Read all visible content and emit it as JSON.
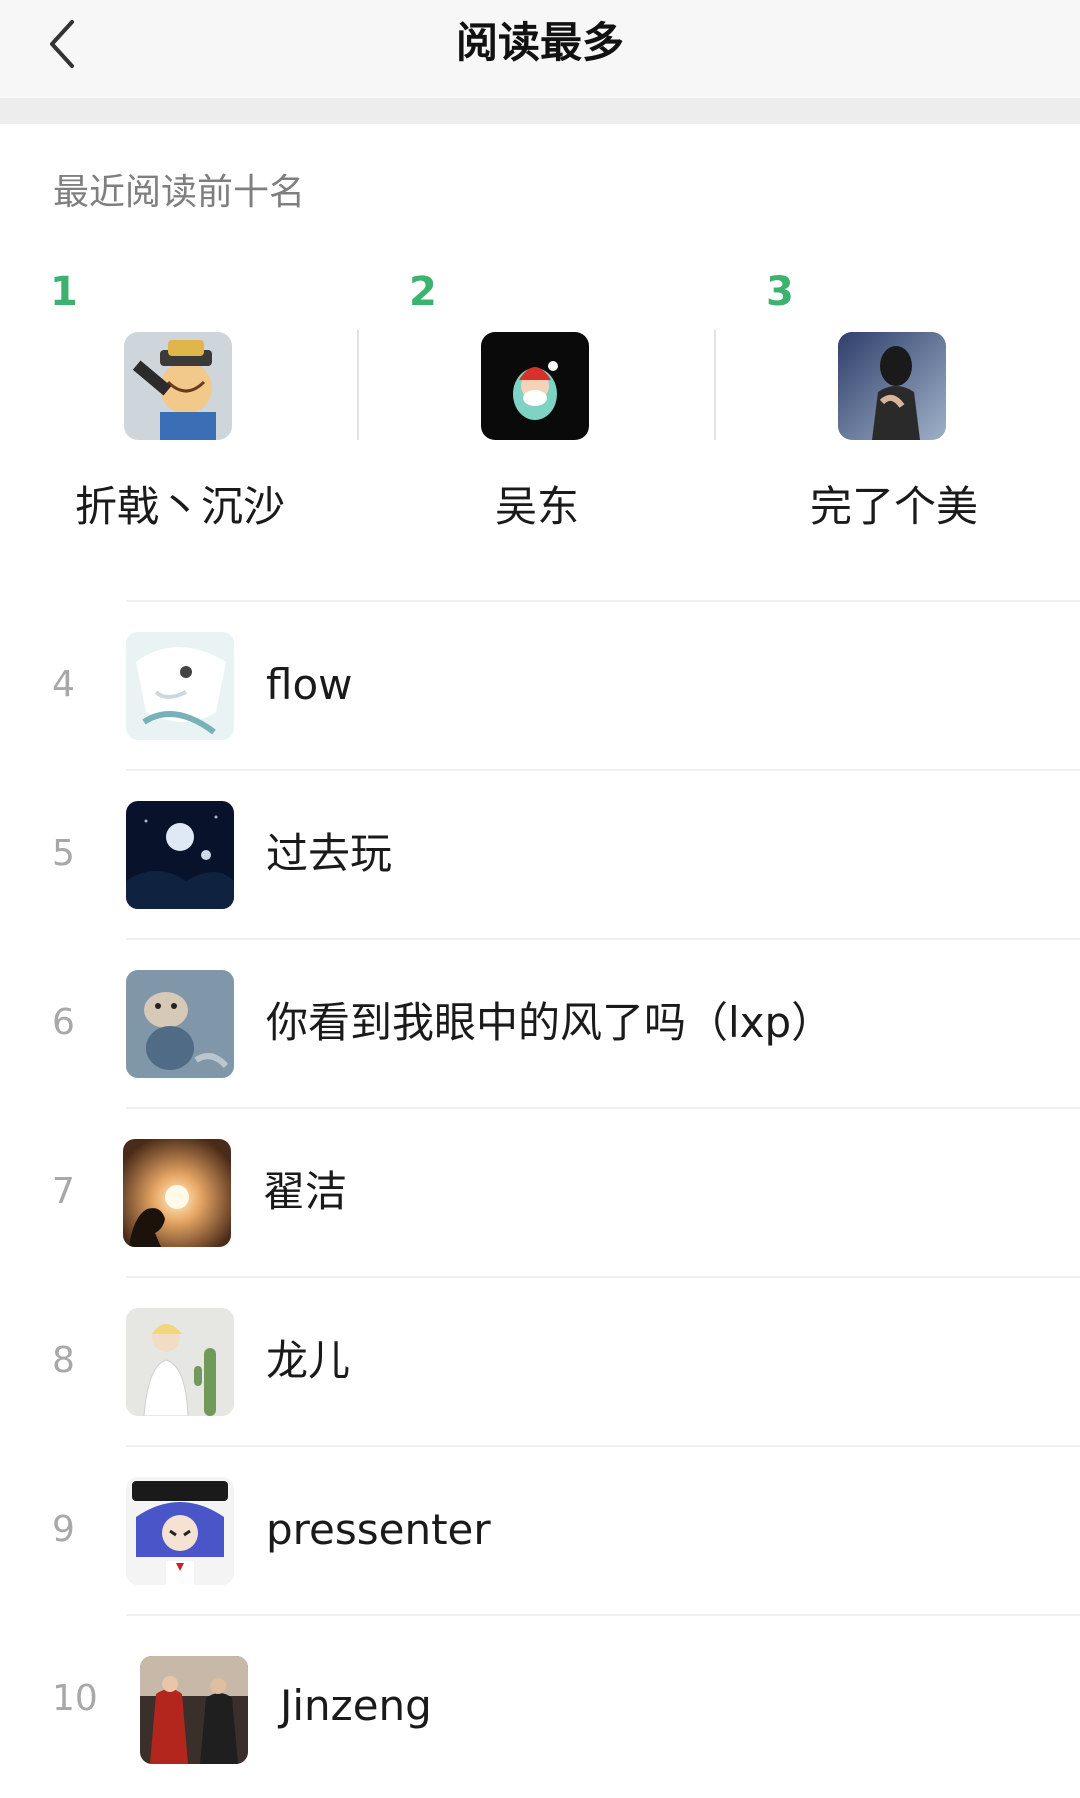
{
  "header": {
    "title": "阅读最多",
    "back_icon": "chevron-left-icon"
  },
  "section": {
    "label": "最近阅读前十名"
  },
  "colors": {
    "accent_green": "#3bb36f",
    "rank_gray": "#a8a8a8",
    "label_gray": "#7f7f7f",
    "header_bg": "#f7f7f7"
  },
  "top3": [
    {
      "rank": "1",
      "name": "折戟丶沉沙"
    },
    {
      "rank": "2",
      "name": "吴东"
    },
    {
      "rank": "3",
      "name": "完了个美"
    }
  ],
  "list": [
    {
      "rank": "4",
      "name": "flow"
    },
    {
      "rank": "5",
      "name": "过去玩"
    },
    {
      "rank": "6",
      "name": "你看到我眼中的风了吗（lxp）"
    },
    {
      "rank": "7",
      "name": "翟洁"
    },
    {
      "rank": "8",
      "name": "龙儿"
    },
    {
      "rank": "9",
      "name": "pressenter"
    },
    {
      "rank": "10",
      "name": "Jinzeng"
    }
  ]
}
